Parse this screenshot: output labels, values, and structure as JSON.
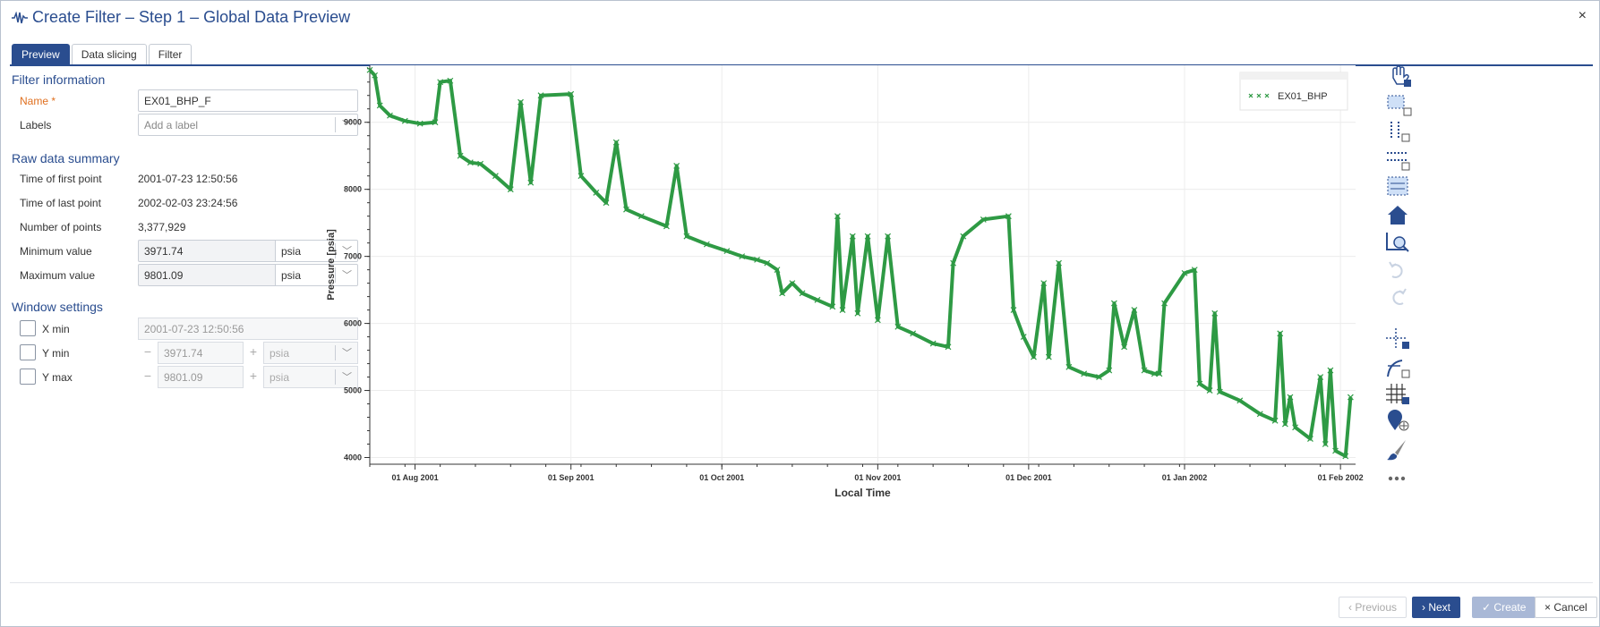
{
  "window": {
    "title": "Create Filter – Step 1 – Global Data Preview",
    "close_glyph": "×"
  },
  "tabs": [
    {
      "label": "Preview",
      "active": true
    },
    {
      "label": "Data slicing",
      "active": false
    },
    {
      "label": "Filter",
      "active": false
    }
  ],
  "filter_info": {
    "section_title": "Filter information",
    "name_label": "Name",
    "required_mark": "*",
    "name_value": "EX01_BHP_F",
    "labels_label": "Labels",
    "labels_placeholder": "Add a label"
  },
  "raw_summary": {
    "section_title": "Raw data summary",
    "first_point_label": "Time of first point",
    "first_point_value": "2001-07-23 12:50:56",
    "last_point_label": "Time of last point",
    "last_point_value": "2002-02-03 23:24:56",
    "num_points_label": "Number of points",
    "num_points_value": "3,377,929",
    "min_label": "Minimum value",
    "min_value": "3971.74",
    "min_unit": "psia",
    "max_label": "Maximum value",
    "max_value": "9801.09",
    "max_unit": "psia"
  },
  "window_settings": {
    "section_title": "Window settings",
    "xmin_label": "X min",
    "xmin_value": "2001-07-23 12:50:56",
    "ymin_label": "Y min",
    "ymin_value": "3971.74",
    "ymin_unit": "psia",
    "ymax_label": "Y max",
    "ymax_value": "9801.09",
    "ymax_unit": "psia",
    "minus_glyph": "−",
    "plus_glyph": "+"
  },
  "toolbar_icons": [
    "pan-icon",
    "box-zoom-icon",
    "x-zoom-icon",
    "y-zoom-icon",
    "box-select-icon",
    "home-icon",
    "zoom-fit-icon",
    "undo-icon",
    "redo-icon",
    "crosshair-icon",
    "hover-icon",
    "grid-icon",
    "marker-icon",
    "brush-icon",
    "more-icon"
  ],
  "footer": {
    "previous_label": "Previous",
    "next_label": "Next",
    "create_label": "Create",
    "cancel_label": "Cancel",
    "prev_glyph": "‹",
    "next_glyph": "›",
    "create_glyph": "✓",
    "cancel_glyph": "×"
  },
  "colors": {
    "accent": "#2a4d8f",
    "series": "#2e9a44"
  },
  "chart_data": {
    "type": "scatter",
    "title": "",
    "xlabel": "Local Time",
    "ylabel": "Pressure [psia]",
    "x_ticks": [
      "01 Aug 2001",
      "01 Sep 2001",
      "01 Oct 2001",
      "01 Nov 2001",
      "01 Dec 2001",
      "01 Jan 2002",
      "01 Feb 2002"
    ],
    "x_range": [
      "2001-07-23",
      "2002-02-04"
    ],
    "ylim": [
      3900,
      9850
    ],
    "y_ticks": [
      4000,
      5000,
      6000,
      7000,
      8000,
      9000
    ],
    "grid": true,
    "legend_position": "top-right",
    "series": [
      {
        "name": "EX01_BHP",
        "color": "#2e9a44",
        "marker": "x",
        "points": [
          [
            "2001-07-23",
            9780
          ],
          [
            "2001-07-24",
            9700
          ],
          [
            "2001-07-25",
            9250
          ],
          [
            "2001-07-27",
            9100
          ],
          [
            "2001-07-30",
            9020
          ],
          [
            "2001-08-02",
            8980
          ],
          [
            "2001-08-05",
            9000
          ],
          [
            "2001-08-06",
            9600
          ],
          [
            "2001-08-08",
            9620
          ],
          [
            "2001-08-10",
            8500
          ],
          [
            "2001-08-12",
            8400
          ],
          [
            "2001-08-14",
            8380
          ],
          [
            "2001-08-17",
            8200
          ],
          [
            "2001-08-20",
            8000
          ],
          [
            "2001-08-22",
            9300
          ],
          [
            "2001-08-24",
            8100
          ],
          [
            "2001-08-26",
            9400
          ],
          [
            "2001-09-01",
            9420
          ],
          [
            "2001-09-03",
            8200
          ],
          [
            "2001-09-06",
            7950
          ],
          [
            "2001-09-08",
            7800
          ],
          [
            "2001-09-10",
            8700
          ],
          [
            "2001-09-12",
            7700
          ],
          [
            "2001-09-15",
            7600
          ],
          [
            "2001-09-20",
            7450
          ],
          [
            "2001-09-22",
            8350
          ],
          [
            "2001-09-24",
            7300
          ],
          [
            "2001-09-28",
            7180
          ],
          [
            "2001-10-02",
            7080
          ],
          [
            "2001-10-05",
            7000
          ],
          [
            "2001-10-08",
            6950
          ],
          [
            "2001-10-10",
            6900
          ],
          [
            "2001-10-12",
            6800
          ],
          [
            "2001-10-13",
            6450
          ],
          [
            "2001-10-15",
            6600
          ],
          [
            "2001-10-17",
            6450
          ],
          [
            "2001-10-20",
            6350
          ],
          [
            "2001-10-23",
            6250
          ],
          [
            "2001-10-24",
            7600
          ],
          [
            "2001-10-25",
            6200
          ],
          [
            "2001-10-27",
            7300
          ],
          [
            "2001-10-28",
            6150
          ],
          [
            "2001-10-30",
            7300
          ],
          [
            "2001-11-01",
            6050
          ],
          [
            "2001-11-03",
            7300
          ],
          [
            "2001-11-05",
            5950
          ],
          [
            "2001-11-08",
            5850
          ],
          [
            "2001-11-12",
            5700
          ],
          [
            "2001-11-15",
            5650
          ],
          [
            "2001-11-16",
            6900
          ],
          [
            "2001-11-18",
            7300
          ],
          [
            "2001-11-22",
            7550
          ],
          [
            "2001-11-27",
            7600
          ],
          [
            "2001-11-28",
            6200
          ],
          [
            "2001-11-30",
            5800
          ],
          [
            "2001-12-02",
            5500
          ],
          [
            "2001-12-04",
            6600
          ],
          [
            "2001-12-05",
            5500
          ],
          [
            "2001-12-07",
            6900
          ],
          [
            "2001-12-09",
            5350
          ],
          [
            "2001-12-12",
            5250
          ],
          [
            "2001-12-15",
            5200
          ],
          [
            "2001-12-17",
            5300
          ],
          [
            "2001-12-18",
            6300
          ],
          [
            "2001-12-20",
            5650
          ],
          [
            "2001-12-22",
            6200
          ],
          [
            "2001-12-24",
            5300
          ],
          [
            "2001-12-26",
            5250
          ],
          [
            "2001-12-27",
            5250
          ],
          [
            "2001-12-28",
            6300
          ],
          [
            "2002-01-01",
            6750
          ],
          [
            "2002-01-03",
            6800
          ],
          [
            "2002-01-04",
            5100
          ],
          [
            "2002-01-06",
            5000
          ],
          [
            "2002-01-07",
            6150
          ],
          [
            "2002-01-08",
            4980
          ],
          [
            "2002-01-12",
            4850
          ],
          [
            "2002-01-16",
            4650
          ],
          [
            "2002-01-19",
            4550
          ],
          [
            "2002-01-20",
            5850
          ],
          [
            "2002-01-21",
            4500
          ],
          [
            "2002-01-22",
            4900
          ],
          [
            "2002-01-23",
            4450
          ],
          [
            "2002-01-26",
            4280
          ],
          [
            "2002-01-28",
            5200
          ],
          [
            "2002-01-29",
            4200
          ],
          [
            "2002-01-30",
            5300
          ],
          [
            "2002-01-31",
            4100
          ],
          [
            "2002-02-02",
            4020
          ],
          [
            "2002-02-03",
            4900
          ]
        ]
      }
    ]
  }
}
